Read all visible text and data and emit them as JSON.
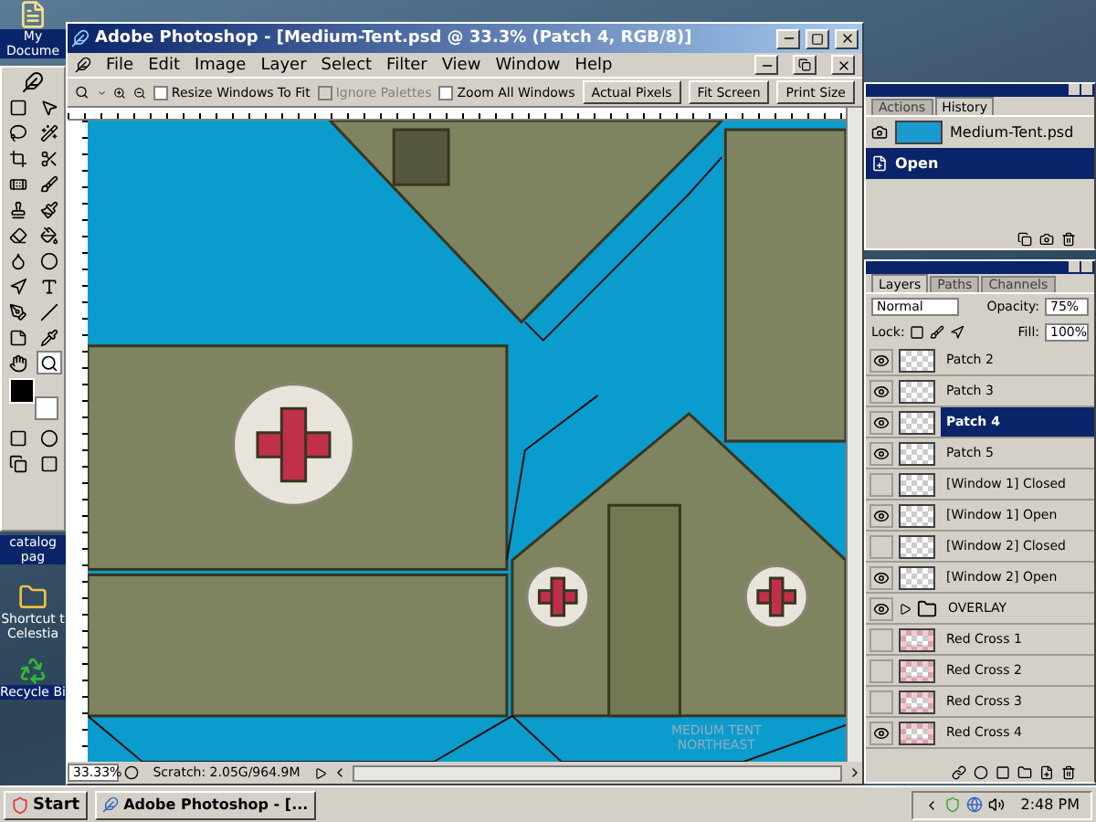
{
  "desktop": {
    "icons": [
      {
        "label": "My Docume",
        "kind": "documents"
      },
      {
        "label": "catalog pag",
        "kind": "label"
      },
      {
        "label": "Shortcut t Celestia",
        "kind": "folder"
      },
      {
        "label": "Recycle Bi",
        "kind": "recycle"
      }
    ]
  },
  "window": {
    "title": "Adobe Photoshop - [Medium-Tent.psd @ 33.3% (Patch 4, RGB/8)]"
  },
  "menu": [
    "File",
    "Edit",
    "Image",
    "Layer",
    "Select",
    "Filter",
    "View",
    "Window",
    "Help"
  ],
  "options_bar": {
    "checkboxes": [
      {
        "label": "Resize Windows To Fit",
        "checked": false,
        "disabled": false
      },
      {
        "label": "Ignore Palettes",
        "checked": false,
        "disabled": true
      },
      {
        "label": "Zoom All Windows",
        "checked": false,
        "disabled": false
      }
    ],
    "buttons": [
      "Actual Pixels",
      "Fit Screen",
      "Print Size"
    ]
  },
  "canvas": {
    "caption": [
      "MEDIUM TENT",
      "NORTHEAST"
    ]
  },
  "status_bar": {
    "zoom": "33.33%",
    "info": "Scratch: 2.05G/964.9M"
  },
  "history_panel": {
    "tabs": [
      {
        "label": "Actions",
        "selected": false
      },
      {
        "label": "History",
        "selected": true
      }
    ],
    "snapshot": "Medium-Tent.psd",
    "states": [
      {
        "label": "Open",
        "selected": true
      }
    ]
  },
  "layers_panel": {
    "tabs": [
      {
        "label": "Layers",
        "selected": true
      },
      {
        "label": "Paths",
        "selected": false
      },
      {
        "label": "Channels",
        "selected": false
      }
    ],
    "blend_mode": "Normal",
    "opacity_label": "Opacity:",
    "opacity": "75%",
    "lock_label": "Lock:",
    "fill_label": "Fill:",
    "fill": "100%",
    "layers": [
      {
        "name": "Patch 2",
        "kind": "layer",
        "visible": true,
        "selected": false
      },
      {
        "name": "Patch 3",
        "kind": "layer",
        "visible": true,
        "selected": false
      },
      {
        "name": "Patch 4",
        "kind": "layer",
        "visible": true,
        "selected": true
      },
      {
        "name": "Patch 5",
        "kind": "layer",
        "visible": true,
        "selected": false
      },
      {
        "name": "[Window 1] Closed",
        "kind": "layer",
        "visible": false,
        "selected": false
      },
      {
        "name": "[Window 1] Open",
        "kind": "layer",
        "visible": true,
        "selected": false
      },
      {
        "name": "[Window 2] Closed",
        "kind": "layer",
        "visible": false,
        "selected": false
      },
      {
        "name": "[Window 2] Open",
        "kind": "layer",
        "visible": true,
        "selected": false
      },
      {
        "name": "OVERLAY",
        "kind": "group",
        "visible": true,
        "selected": false
      },
      {
        "name": "Red Cross 1",
        "kind": "cross",
        "visible": false,
        "selected": false
      },
      {
        "name": "Red Cross 2",
        "kind": "cross",
        "visible": false,
        "selected": false
      },
      {
        "name": "Red Cross 3",
        "kind": "cross",
        "visible": false,
        "selected": false
      },
      {
        "name": "Red Cross 4",
        "kind": "cross",
        "visible": true,
        "selected": false
      }
    ]
  },
  "taskbar": {
    "start": "Start",
    "tasks": [
      {
        "label": "Adobe Photoshop - [...",
        "selected": false
      }
    ],
    "clock": "2:48 PM"
  }
}
